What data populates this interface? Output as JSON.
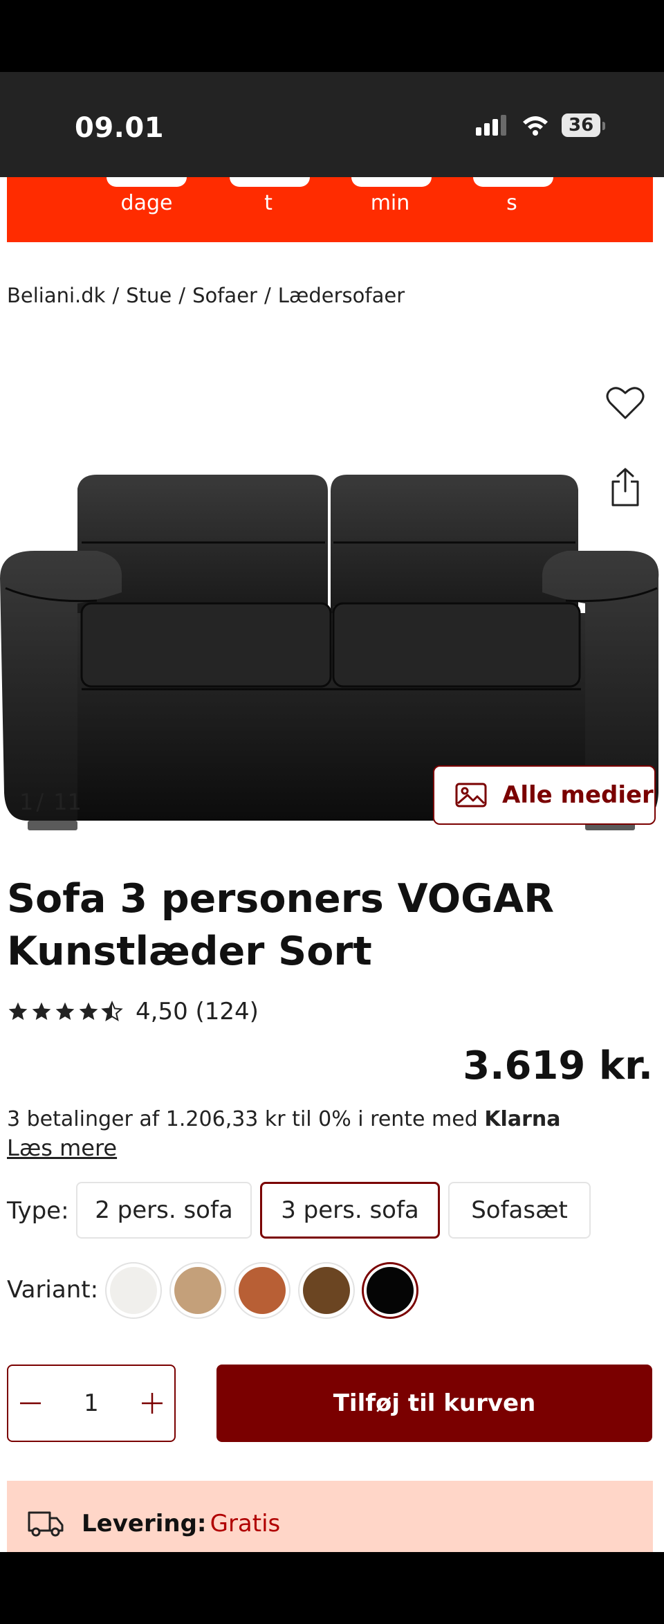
{
  "status_bar": {
    "time": "09.01",
    "battery": "36"
  },
  "promo": {
    "units": [
      "dage",
      "t",
      "min",
      "s"
    ]
  },
  "breadcrumb": {
    "items": [
      "Beliani.dk",
      "Stue",
      "Sofaer",
      "Lædersofaer"
    ],
    "separator": "/"
  },
  "gallery": {
    "current": "1",
    "separator": "/",
    "total": "11",
    "media_button": "Alle medier"
  },
  "product": {
    "title": "Sofa 3 personers VOGAR Kunstlæder Sort",
    "rating": 4.5,
    "rating_text": "4,50 (124)",
    "price": "3.619 kr."
  },
  "klarna": {
    "text": "3 betalinger af 1.206,33 kr til 0% i rente med ",
    "brand": "Klarna",
    "read_more": "Læs mere"
  },
  "type": {
    "label": "Type:",
    "options": [
      "2 pers. sofa",
      "3 pers. sofa",
      "Sofasæt"
    ],
    "selected": "3 pers. sofa"
  },
  "variant": {
    "label": "Variant:",
    "colors": [
      "#f0efec",
      "#c4a07a",
      "#b85f35",
      "#6b4522",
      "#050505"
    ],
    "selected_index": 4
  },
  "quantity": {
    "value": "1"
  },
  "cart": {
    "add_label": "Tilføj til kurven"
  },
  "delivery": {
    "label": "Levering:",
    "value": "Gratis"
  },
  "colors": {
    "accent": "#7a0000",
    "promo": "#ff2c00",
    "delivery_bg": "#ffd6c8"
  }
}
